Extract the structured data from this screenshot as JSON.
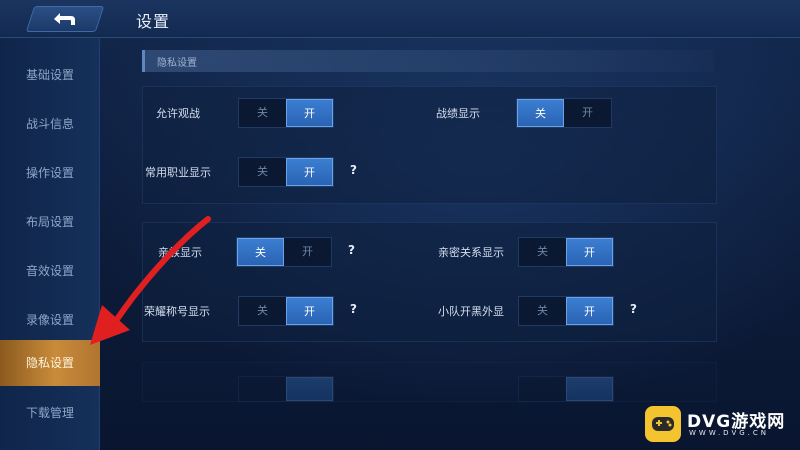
{
  "header": {
    "title": "设置"
  },
  "sidebar": {
    "items": [
      {
        "label": "基础设置"
      },
      {
        "label": "战斗信息"
      },
      {
        "label": "操作设置"
      },
      {
        "label": "布局设置"
      },
      {
        "label": "音效设置"
      },
      {
        "label": "录像设置"
      },
      {
        "label": "隐私设置",
        "active": true
      },
      {
        "label": "下载管理"
      }
    ]
  },
  "section": {
    "title": "隐私设置"
  },
  "toggle_labels": {
    "off": "关",
    "on": "开"
  },
  "help_symbol": "?",
  "settings": [
    {
      "label": "允许观战",
      "value": "开"
    },
    {
      "label": "战绩显示",
      "value": "关"
    },
    {
      "label": "常用职业显示",
      "value": "开",
      "help": true
    },
    {
      "label": "亲族显示",
      "value": "关",
      "help": true
    },
    {
      "label": "亲密关系显示",
      "value": "开"
    },
    {
      "label": "荣耀称号显示",
      "value": "开",
      "help": true
    },
    {
      "label": "小队开黑外显",
      "value": "开",
      "help": true
    }
  ],
  "watermark": {
    "name": "DVG游戏网",
    "url": "WWW.DVG.CN"
  },
  "colors": {
    "accent_on": "#3b7ed1",
    "active_tab": "#c98b3b",
    "annotation": "#e02020"
  }
}
